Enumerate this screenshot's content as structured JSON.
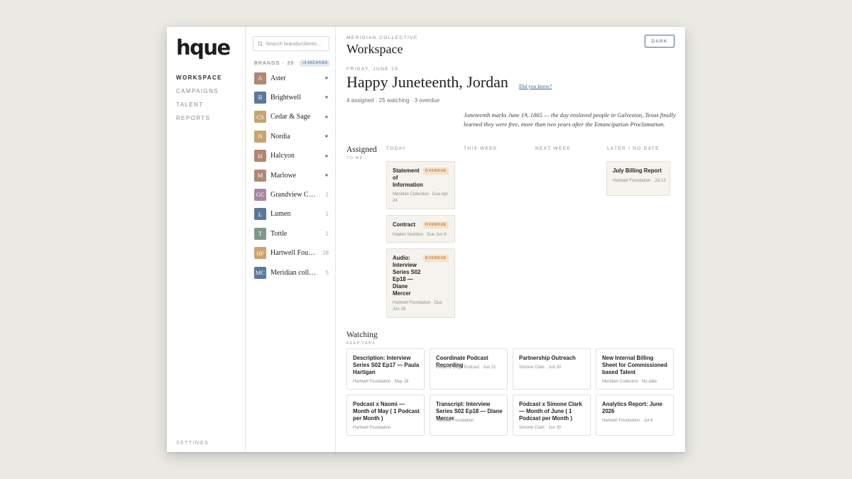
{
  "nav": {
    "logo": "hque",
    "items": [
      "WORKSPACE",
      "CAMPAIGNS",
      "TALENT",
      "REPORTS"
    ],
    "settings": "SETTINGS"
  },
  "brands": {
    "search_placeholder": "Search brands/clients...",
    "title": "BRANDS · 39",
    "archived": "+6 ARCHIVED",
    "list": [
      {
        "initials": "A",
        "name": "Aster",
        "starred": true,
        "count": "",
        "color": "#b08774"
      },
      {
        "initials": "B",
        "name": "Brightwell",
        "starred": true,
        "count": "",
        "color": "#5b789c"
      },
      {
        "initials": "CS",
        "name": "Cedar & Sage",
        "starred": true,
        "count": "",
        "color": "#c6a470"
      },
      {
        "initials": "N",
        "name": "Nordia",
        "starred": true,
        "count": "",
        "color": "#c8a46f"
      },
      {
        "initials": "H",
        "name": "Halcyon",
        "starred": true,
        "count": "",
        "color": "#b08774"
      },
      {
        "initials": "M",
        "name": "Marlowe",
        "starred": true,
        "count": "",
        "color": "#b08774"
      },
      {
        "initials": "GC",
        "name": "Grandview Consulting",
        "starred": false,
        "count": "1",
        "color": "#a7879f"
      },
      {
        "initials": "L",
        "name": "Lumen",
        "starred": false,
        "count": "1",
        "color": "#5b789c"
      },
      {
        "initials": "T",
        "name": "Tottle",
        "starred": false,
        "count": "1",
        "color": "#7f988a"
      },
      {
        "initials": "HF",
        "name": "Hartwell Foundation",
        "starred": false,
        "count": "28",
        "color": "#c8a46f"
      },
      {
        "initials": "MC",
        "name": "Meridian collective",
        "starred": false,
        "count": "5",
        "color": "#5b789c"
      }
    ]
  },
  "main": {
    "org": "MERIDIAN COLLECTIVE",
    "title": "Workspace",
    "dark_button": "DARK",
    "date": "FRIDAY, JUNE 19",
    "greeting": "Happy Juneteenth, Jordan",
    "did_you_know": "Did you know?",
    "stats": "4 assigned · 25 watching · 3 overdue",
    "fact": "Juneteenth marks June 19, 1865 — the day enslaved people in Galveston, Texas finally learned they were free, more than two years after the Emancipation Proclamation."
  },
  "assigned": {
    "title": "Assigned",
    "subtitle": "TO ME",
    "columns": [
      "TODAY",
      "THIS WEEK",
      "NEXT WEEK",
      "LATER / NO DATE"
    ],
    "today": [
      {
        "title": "Statement of Information",
        "meta": "Meridian Collective · Due Apr 24",
        "badge": "OVERDUE"
      },
      {
        "title": "Contract",
        "meta": "Halden Nutrition · Due Jun 5",
        "badge": "OVERDUE"
      },
      {
        "title": "Audio: Interview Series S02 Ep18 — Diane Mercer",
        "meta": "Hartwell Foundation · Due Jun 18",
        "badge": "OVERDUE"
      }
    ],
    "later": [
      {
        "title": "July Billing Report",
        "meta": "Hartwell Foundation · Jul 13"
      }
    ]
  },
  "watching": {
    "title": "Watching",
    "subtitle": "KEEP TABS",
    "items": [
      {
        "title": "Description: Interview Series S02 Ep17 — Paula Hartigan",
        "meta": "Hartwell Foundation · May 28"
      },
      {
        "title": "Coordinate Podcast Recording",
        "meta": "Cedar & Sage Podcast · Jun 22"
      },
      {
        "title": "Partnership Outreach",
        "meta": "Simone Clark · Jun 30"
      },
      {
        "title": "New Internal Billing Sheet for Commissioned based Talent",
        "meta": "Meridian Collective · No date"
      },
      {
        "title": "Podcast x Naomi — Month of May ( 1 Podcast per Month )",
        "meta": "Hartwell Foundation"
      },
      {
        "title": "Transcript: Interview Series S02 Ep18 — Diane Mercer",
        "meta": "Hartwell Foundation"
      },
      {
        "title": "Podcast x Simone Clark — Month of June ( 1 Podcast per Month )",
        "meta": "Simone Clark · Jun 30"
      },
      {
        "title": "Analytics Report: June 2026",
        "meta": "Hartwell Foundation · Jul 6"
      }
    ]
  }
}
